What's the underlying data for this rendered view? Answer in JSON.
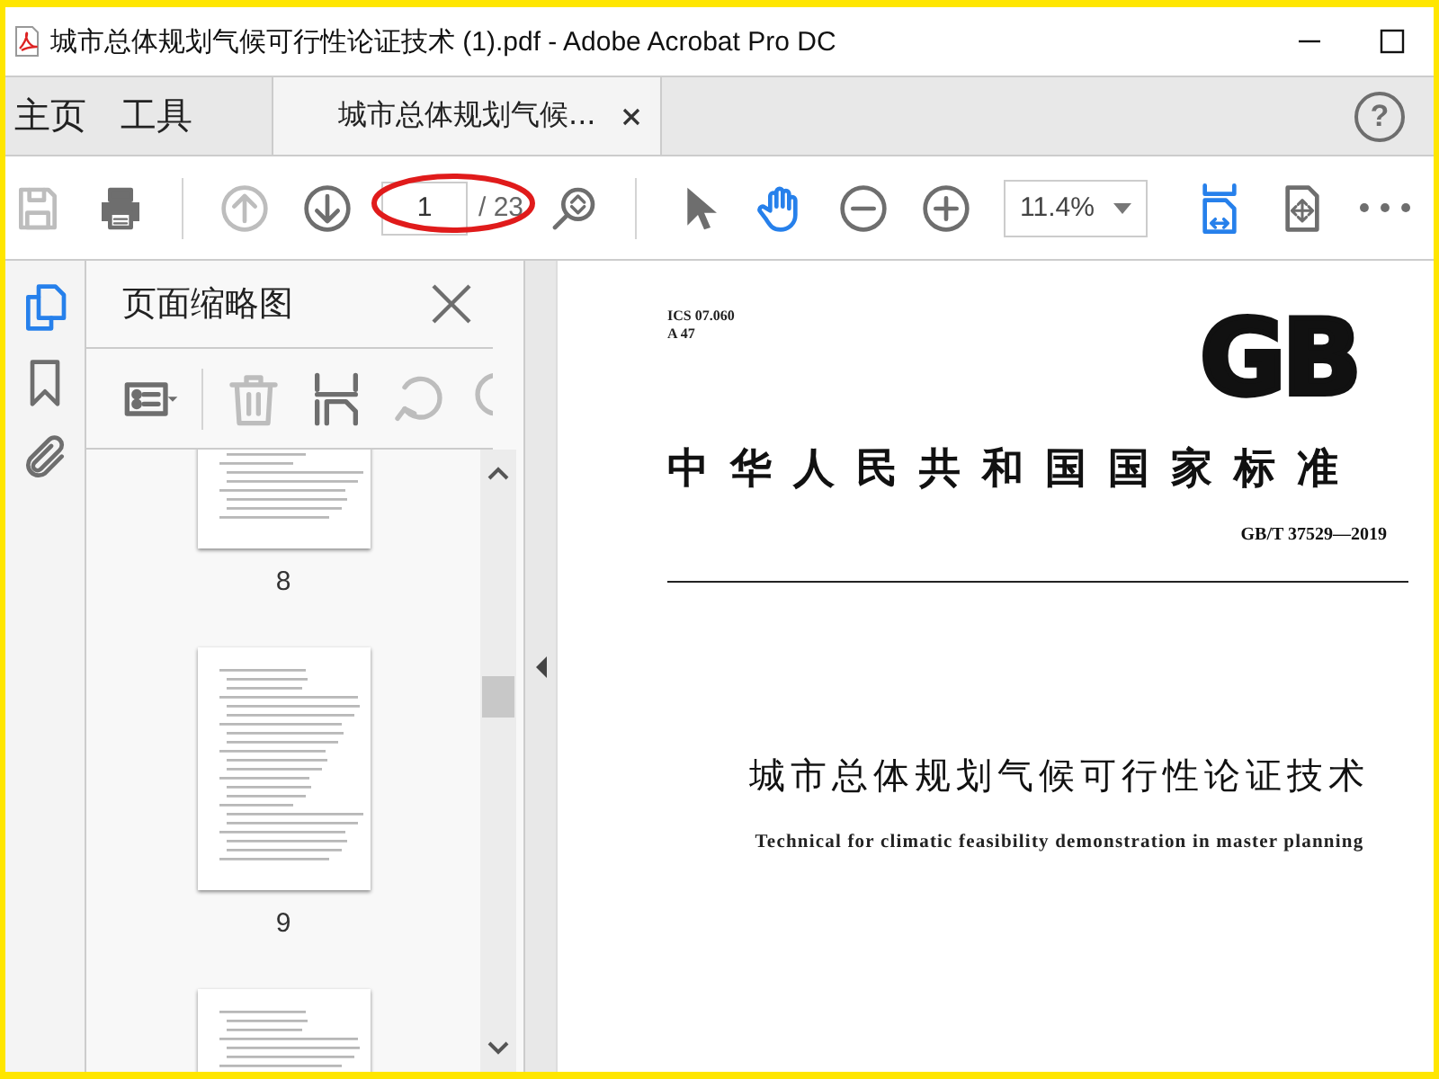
{
  "window": {
    "title": "城市总体规划气候可行性论证技术 (1).pdf - Adobe Acrobat Pro DC"
  },
  "nav_tabs": [
    {
      "label": "主页",
      "selected": false,
      "closable": false
    },
    {
      "label": "工具",
      "selected": false,
      "closable": false
    },
    {
      "label": "城市总体规划气候...",
      "selected": true,
      "closable": true
    }
  ],
  "help": {
    "label": "?"
  },
  "toolbar": [
    {
      "kind": "save",
      "disabled": true,
      "active": false
    },
    {
      "kind": "print",
      "disabled": false,
      "active": false
    },
    {
      "kind": "separator"
    },
    {
      "kind": "page-up",
      "disabled": true,
      "active": false
    },
    {
      "kind": "page-down",
      "disabled": false,
      "active": false
    },
    {
      "kind": "page-field",
      "value": "1",
      "total": "/ 23",
      "highlighted": true
    },
    {
      "kind": "zoom-page",
      "disabled": false,
      "active": false
    },
    {
      "kind": "separator"
    },
    {
      "kind": "select",
      "disabled": false,
      "active": false
    },
    {
      "kind": "hand",
      "disabled": false,
      "active": true
    },
    {
      "kind": "zoom-out",
      "disabled": false,
      "active": false
    },
    {
      "kind": "zoom-in",
      "disabled": false,
      "active": false
    },
    {
      "kind": "zoom-select",
      "value": "11.4%"
    },
    {
      "kind": "fit-width",
      "disabled": false,
      "active": true
    },
    {
      "kind": "full-screen",
      "disabled": false,
      "active": false
    },
    {
      "kind": "more",
      "disabled": false,
      "active": false
    }
  ],
  "side_icons": [
    {
      "kind": "pages",
      "selected": true
    },
    {
      "kind": "bookmarks",
      "selected": false
    },
    {
      "kind": "attachments",
      "selected": false
    }
  ],
  "thumbnail_panel": {
    "title": "页面缩略图",
    "tools": [
      {
        "kind": "options",
        "disabled": false
      },
      {
        "kind": "delete",
        "disabled": true
      },
      {
        "kind": "insert",
        "disabled": false
      },
      {
        "kind": "rotate-ccw",
        "disabled": true
      },
      {
        "kind": "rotate-cw",
        "disabled": true
      }
    ],
    "thumbnails": [
      {
        "label": "8"
      },
      {
        "label": "9"
      }
    ],
    "next_thumbnail_partial": true
  },
  "document": {
    "ics": "ICS 07.060",
    "ccs": "A 47",
    "logo": "GB",
    "heading": "中华人民共和国国家标准",
    "code": "GB/T 37529—2019",
    "title_zh": "城市总体规划气候可行性论证技术",
    "title_en": "Technical for climatic feasibility demonstration in master planning"
  }
}
